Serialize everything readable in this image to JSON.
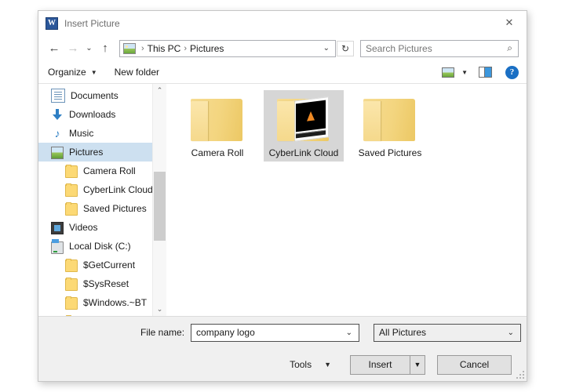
{
  "dialog": {
    "title": "Insert Picture",
    "app_icon": "word-icon",
    "app_icon_letter": "W",
    "close_label": "✕"
  },
  "nav": {
    "back": "←",
    "forward": "→",
    "recent": "⌄",
    "up": "↑",
    "breadcrumb": [
      "This PC",
      "Pictures"
    ],
    "separator": "›",
    "dropdown": "⌄",
    "refresh": "↻",
    "search_placeholder": "Search Pictures",
    "search_icon": "⌕"
  },
  "toolbar": {
    "organize": "Organize",
    "organize_caret": "▼",
    "new_folder": "New folder",
    "view_caret": "▼",
    "help": "?"
  },
  "sidebar": {
    "items": [
      {
        "label": "Documents",
        "icon": "document-icon",
        "indent": false,
        "selected": false
      },
      {
        "label": "Downloads",
        "icon": "download-icon",
        "indent": false,
        "selected": false
      },
      {
        "label": "Music",
        "icon": "music-icon",
        "indent": false,
        "selected": false
      },
      {
        "label": "Pictures",
        "icon": "pictures-icon",
        "indent": false,
        "selected": true
      },
      {
        "label": "Camera Roll",
        "icon": "folder-icon",
        "indent": true,
        "selected": false
      },
      {
        "label": "CyberLink Cloud",
        "icon": "folder-icon",
        "indent": true,
        "selected": false
      },
      {
        "label": "Saved Pictures",
        "icon": "folder-icon",
        "indent": true,
        "selected": false
      },
      {
        "label": "Videos",
        "icon": "video-icon",
        "indent": false,
        "selected": false
      },
      {
        "label": "Local Disk (C:)",
        "icon": "disk-icon",
        "indent": false,
        "selected": false
      },
      {
        "label": "$GetCurrent",
        "icon": "folder-icon",
        "indent": true,
        "selected": false
      },
      {
        "label": "$SysReset",
        "icon": "folder-icon",
        "indent": true,
        "selected": false
      },
      {
        "label": "$Windows.~BT",
        "icon": "folder-icon",
        "indent": true,
        "selected": false
      }
    ],
    "scroll_up": "⌃",
    "scroll_down": "⌄"
  },
  "files": {
    "items": [
      {
        "label": "Camera Roll",
        "selected": false,
        "has_thumbnail": false
      },
      {
        "label": "CyberLink Cloud",
        "selected": true,
        "has_thumbnail": true
      },
      {
        "label": "Saved Pictures",
        "selected": false,
        "has_thumbnail": false
      }
    ]
  },
  "bottom": {
    "filename_label": "File name:",
    "filename_value": "company logo",
    "filename_caret": "⌄",
    "filter_value": "All Pictures",
    "filter_caret": "⌄",
    "tools_label": "Tools",
    "tools_caret": "▼",
    "insert_label": "Insert",
    "insert_caret": "▼",
    "cancel_label": "Cancel"
  },
  "colors": {
    "accent": "#2b579a",
    "selection": "#cde0f0",
    "item_selection": "#d6d6d6",
    "folder": "#f3d57f",
    "help_blue": "#1a6fc4"
  }
}
